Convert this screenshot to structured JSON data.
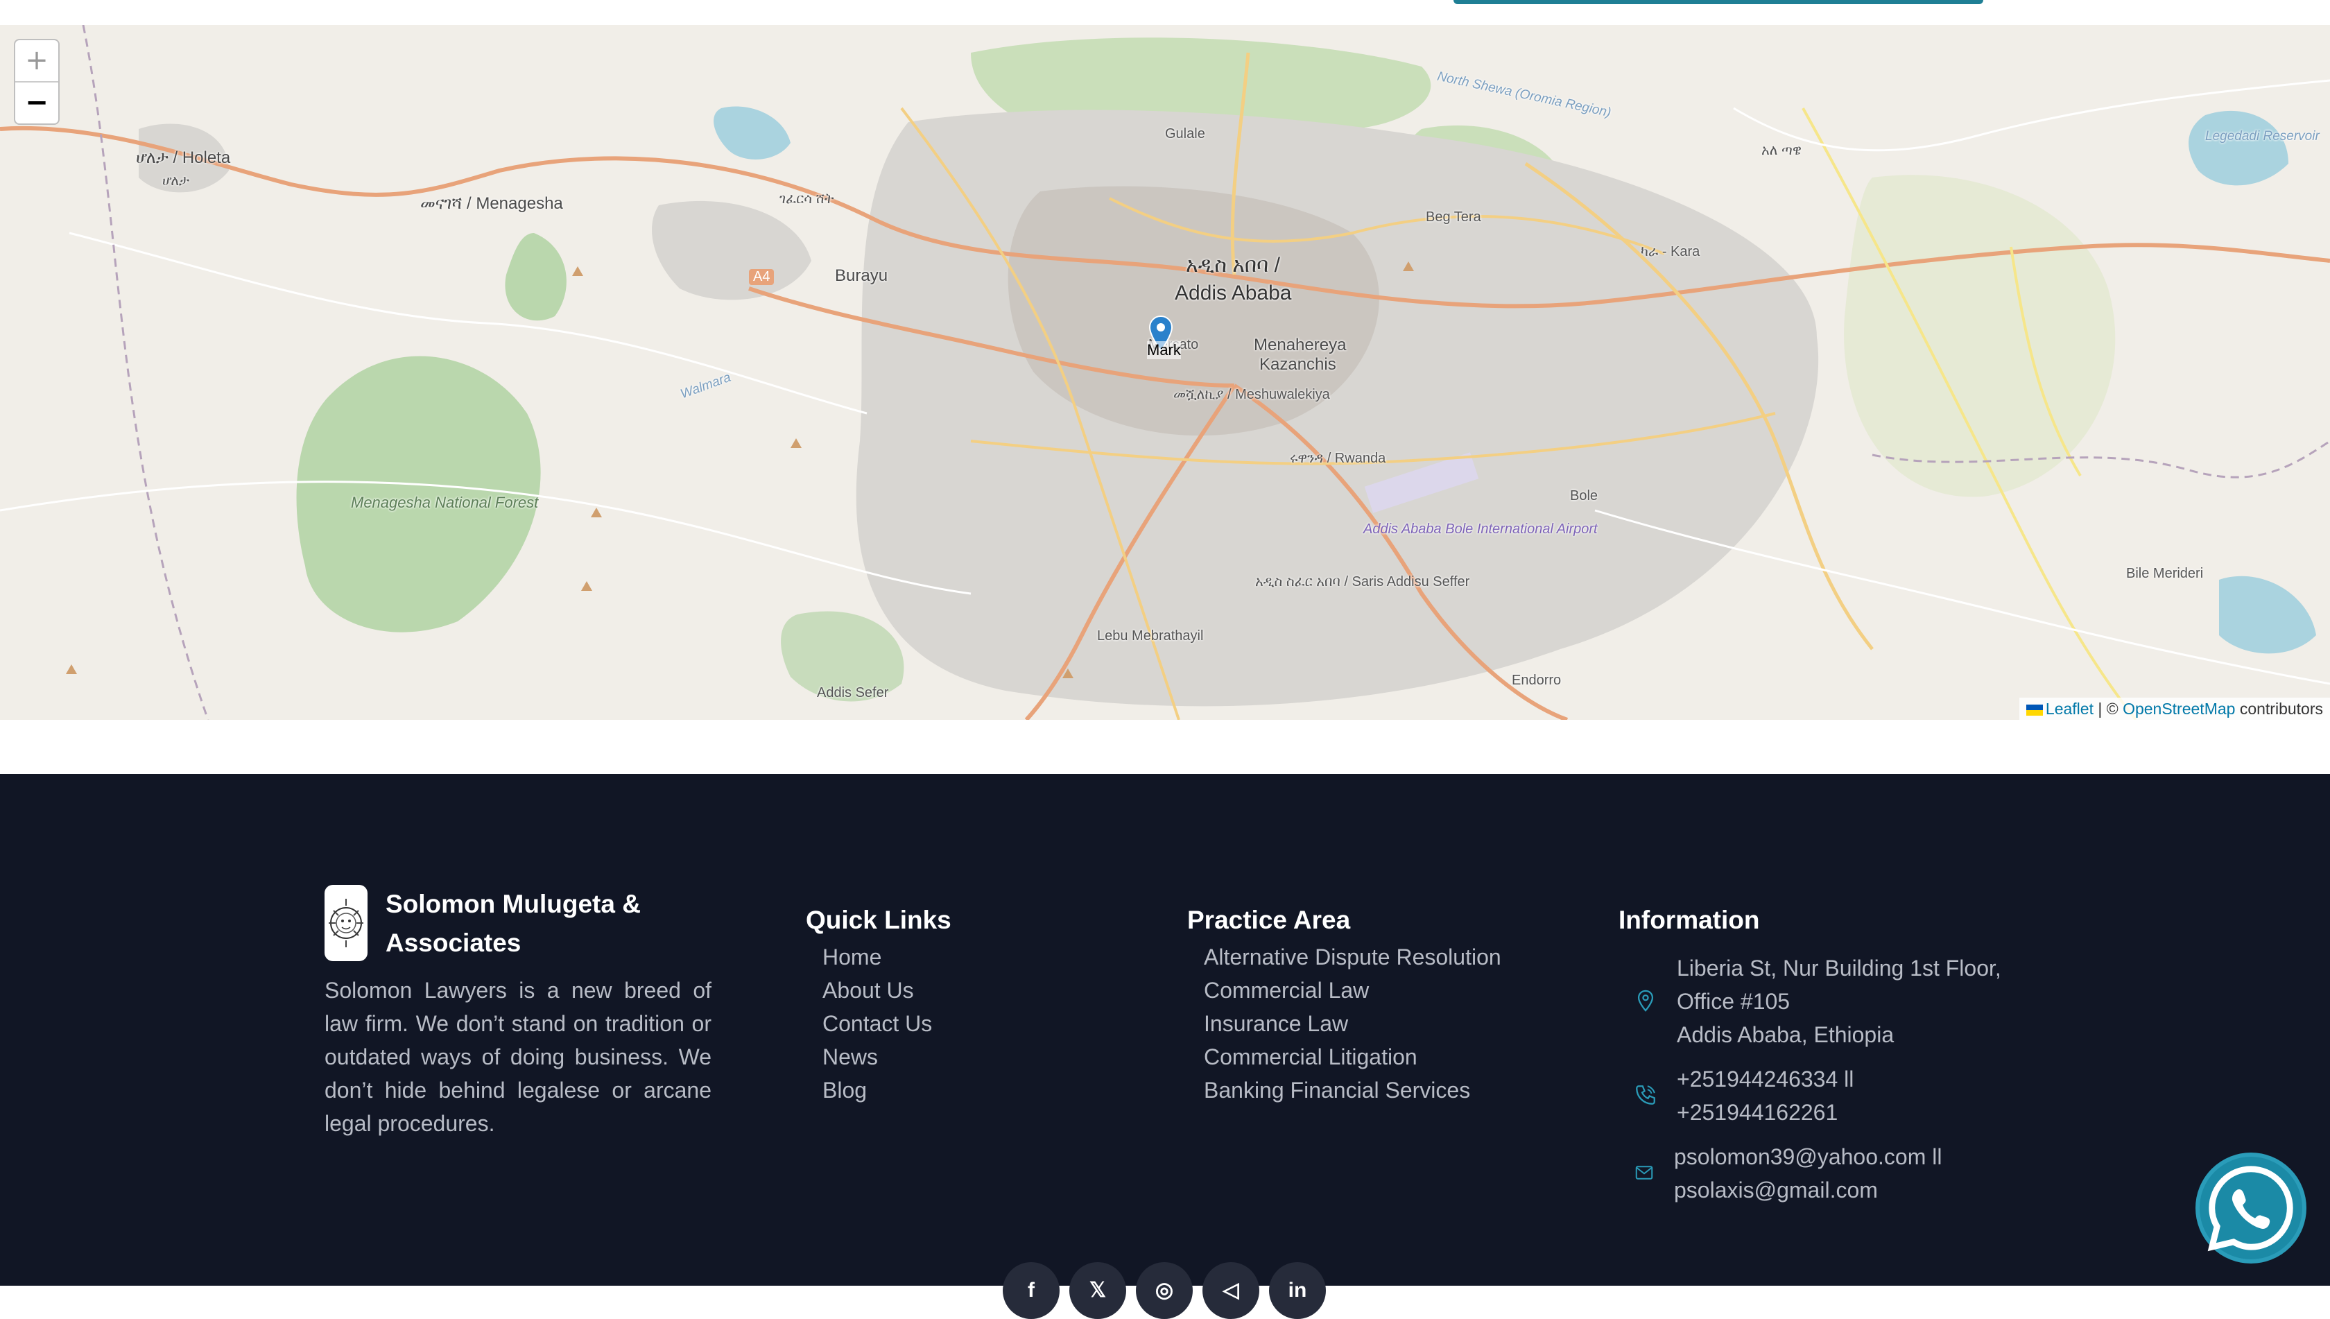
{
  "map": {
    "zoom_in_label": "+",
    "zoom_out_label": "−",
    "marker_label": "Mark",
    "attribution": {
      "leaflet": "Leaflet",
      "separator": "| ©",
      "osm": "OpenStreetMap",
      "suffix": "contributors"
    },
    "labels": {
      "holeta_am": "ሆለታ / Holeta",
      "holeta_small": "ሆለታ",
      "menagesha": "መናገሻ / Menagesha",
      "burayu_am": "ገፈርሳ ሸት",
      "burayu": "Burayu",
      "gulale": "Gulale",
      "north_shewa": "North Shewa (Oromia Region)",
      "beg_tera": "Beg Tera",
      "aba_amharic": "አለ ጣዌ",
      "legedadi": "Legedadi Reservoir",
      "addis_am": "አዲስ አበባ /",
      "addis": "Addis Ababa",
      "mercato": "Mercato",
      "menahereya": "Menahereya",
      "kazanchis": "Kazanchis",
      "meshuwalekiya": "መሿለኪያ / Meshuwalekiya",
      "kara": "ካራ - Kara",
      "rwanda": "ሩዋንዳ / Rwanda",
      "bole": "Bole",
      "airport": "Addis Ababa Bole International Airport",
      "menagesha_forest": "Menagesha National Forest",
      "walmara": "Walmara",
      "lebu": "Lebu Mebrathayil",
      "saris": "አዲስ ስፈር አበባ / Saris Addisu Seffer",
      "addis_sefer": "Addis Sefer",
      "bile": "Bile Merideri",
      "endorro": "Endorro",
      "a4": "A4"
    }
  },
  "footer": {
    "brand": {
      "name": "Solomon Mulugeta & Associates",
      "description": "Solomon Lawyers is a new breed of law firm. We don’t stand on tradition or outdated ways of doing business. We don’t hide behind legalese or arcane legal procedures."
    },
    "quick_links": {
      "title": "Quick Links",
      "items": [
        "Home",
        "About Us",
        "Contact Us",
        "News",
        "Blog"
      ]
    },
    "practice_area": {
      "title": "Practice Area",
      "items": [
        "Alternative Dispute Resolution",
        "Commercial Law",
        "Insurance Law",
        "Commercial Litigation",
        "Banking Financial Services"
      ]
    },
    "information": {
      "title": "Information",
      "address_line1": "Liberia St, Nur Building 1st Floor,",
      "address_line2": "Office #105",
      "address_line3": "Addis Ababa, Ethiopia",
      "phone_line1": "+251944246334 ll",
      "phone_line2": "+251944162261",
      "email_line1": "psolomon39@yahoo.com ll",
      "email_line2": "psolaxis@gmail.com"
    },
    "social": [
      "f",
      "𝕏",
      "◎",
      "◁",
      "in"
    ]
  },
  "colors": {
    "footer_bg": "#111625",
    "accent": "#1f7f95",
    "footer_text": "#b8bcc6"
  }
}
